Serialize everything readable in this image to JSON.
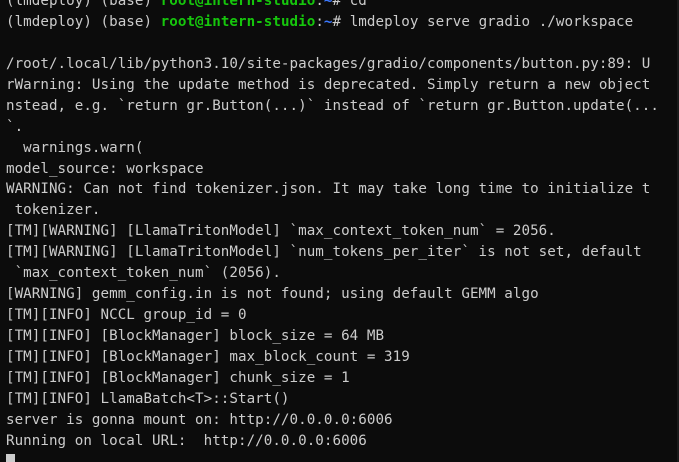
{
  "terminal": {
    "top_line": {
      "env1": "(lmdeploy)",
      "env2": "(base)",
      "user_host": "root@intern-studio",
      "sep": ":",
      "path": "~",
      "rest": "# cd"
    },
    "command_line": {
      "env1": "(lmdeploy)",
      "env2": "(base)",
      "user_host": "root@intern-studio",
      "sep": ":",
      "path": "~",
      "prompt": "#",
      "command": "lmdeploy serve gradio ./workspace"
    },
    "output": [
      "",
      "/root/.local/lib/python3.10/site-packages/gradio/components/button.py:89: U",
      "rWarning: Using the update method is deprecated. Simply return a new object",
      "nstead, e.g. `return gr.Button(...)` instead of `return gr.Button.update(...",
      "`.",
      "  warnings.warn(",
      "model_source: workspace",
      "WARNING: Can not find tokenizer.json. It may take long time to initialize t",
      " tokenizer.",
      "[TM][WARNING] [LlamaTritonModel] `max_context_token_num` = 2056.",
      "[TM][WARNING] [LlamaTritonModel] `num_tokens_per_iter` is not set, default",
      " `max_context_token_num` (2056).",
      "[WARNING] gemm_config.in is not found; using default GEMM algo",
      "[TM][INFO] NCCL group_id = 0",
      "[TM][INFO] [BlockManager] block_size = 64 MB",
      "[TM][INFO] [BlockManager] max_block_count = 319",
      "[TM][INFO] [BlockManager] chunk_size = 1",
      "[TM][INFO] LlamaBatch<T>::Start()",
      "server is gonna mount on: http://0.0.0.0:6006",
      "Running on local URL:  http://0.0.0.0:6006"
    ]
  }
}
